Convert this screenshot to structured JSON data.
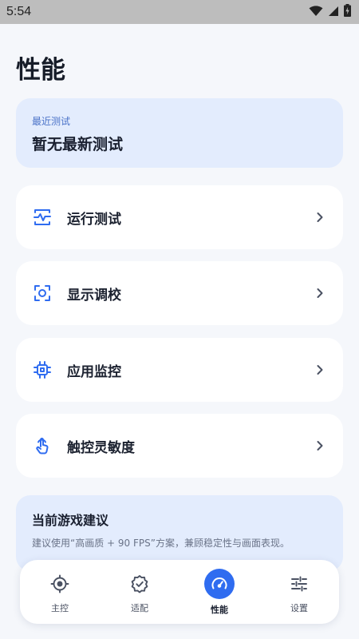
{
  "status_bar": {
    "time": "5:54"
  },
  "page": {
    "title": "性能"
  },
  "recent_test": {
    "label": "最近测试",
    "value": "暂无最新测试"
  },
  "menu": [
    {
      "label": "运行测试",
      "icon": "pulse-icon"
    },
    {
      "label": "显示调校",
      "icon": "screen-focus-icon"
    },
    {
      "label": "应用监控",
      "icon": "chip-icon"
    },
    {
      "label": "触控灵敏度",
      "icon": "touch-icon"
    }
  ],
  "suggestion": {
    "title": "当前游戏建议",
    "text": "建议使用“高画质 + 90 FPS”方案，兼顾稳定性与画面表现。"
  },
  "bottom_nav": [
    {
      "label": "主控",
      "icon": "target-icon",
      "active": false
    },
    {
      "label": "适配",
      "icon": "badge-check-icon",
      "active": false
    },
    {
      "label": "性能",
      "icon": "speedometer-icon",
      "active": true
    },
    {
      "label": "设置",
      "icon": "sliders-icon",
      "active": false
    }
  ],
  "colors": {
    "accent": "#2f6cf0",
    "card_tint": "#e3ecfd",
    "background": "#f5f7fb"
  }
}
